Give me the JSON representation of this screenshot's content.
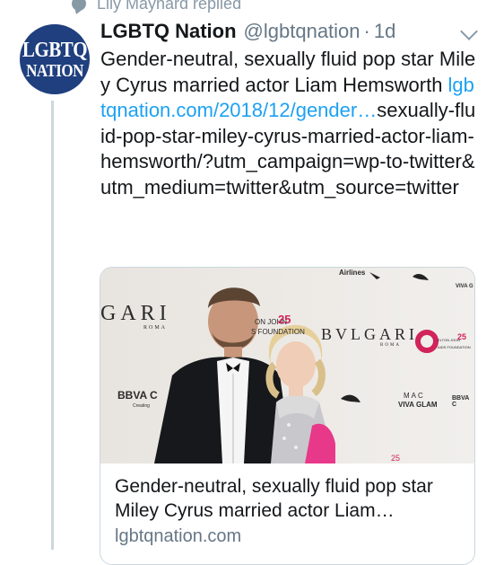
{
  "social_context": {
    "text": "Lily Maynard replied"
  },
  "tweet": {
    "avatar": {
      "line1": "LGBTQ",
      "line2": "NATION"
    },
    "author_name": "LGBTQ Nation",
    "handle": "@lgbtqnation",
    "separator": "·",
    "time": "1d",
    "text_plain": "Gender-neutral, sexually fluid pop star Miley Cyrus married actor Liam Hemsworth ",
    "link_display": "lgbtqnation.com/2018/12/gender…",
    "text_after_link": "sexually-fluid-pop-star-miley-cyrus-married-actor-liam-hemsworth/?utm_campaign=wp-to-twitter&utm_medium=twitter&utm_source=twitter"
  },
  "card": {
    "title": "Gender-neutral, sexually fluid pop star Miley Cyrus married actor Liam…",
    "domain": "lgbtqnation.com",
    "backdrop": {
      "gari": "GARI",
      "roma": "ROMA",
      "bvlgari": "BVLGARI",
      "roma2": "ROMA",
      "bbva": "BBVA C",
      "creating": "Creating",
      "airlines": "Airlines",
      "foundation": "ON JOHN",
      "foundation2": "S FOUNDATION",
      "years": "25",
      "viva": "VIVA GLAM",
      "mac": "MAC",
      "bbva2": "BBVA C",
      "elton": "ELTON JOHN",
      "aids": "AIDS FOUNDATION",
      "num25b": "25",
      "num25c": "25",
      "viva_top": "VIVA G"
    }
  },
  "colors": {
    "link": "#1da1f2",
    "secondary": "#657786",
    "avatar_bg": "#1f3f7e"
  }
}
